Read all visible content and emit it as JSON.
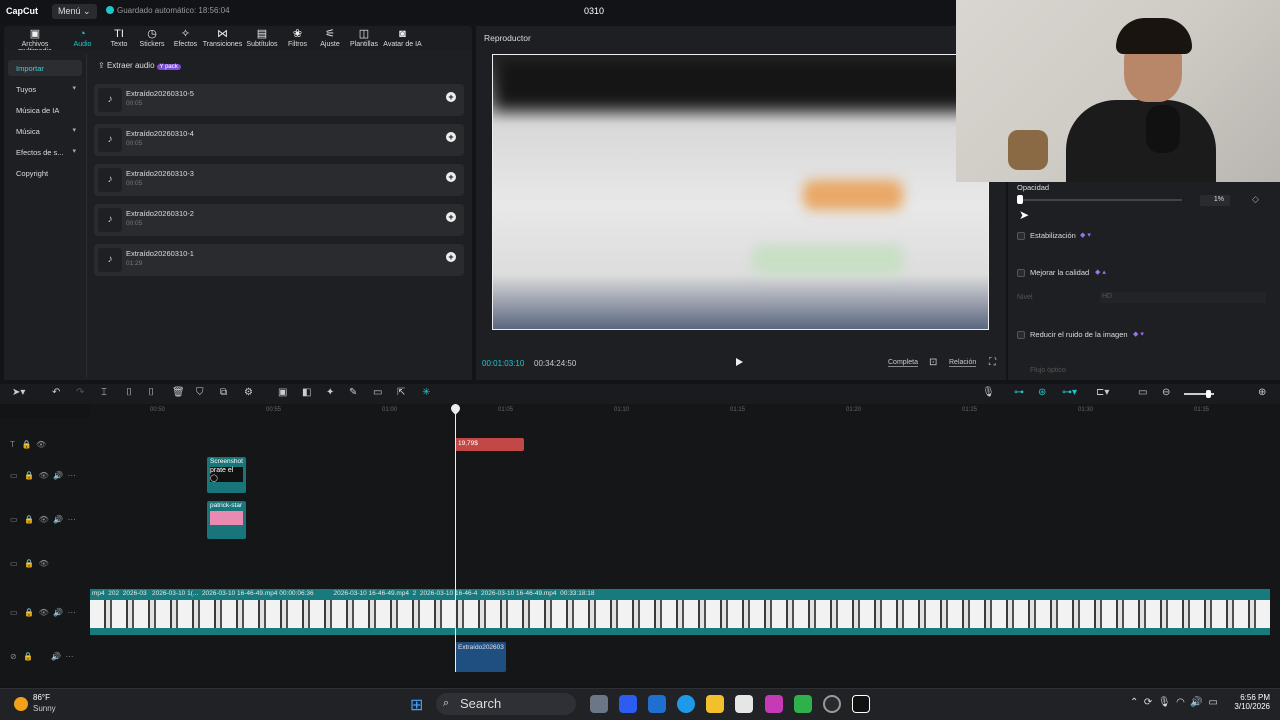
{
  "app": {
    "logo": "CapCut",
    "menu": "Menú ⌄",
    "autosave": "Guardado automático: 18:56:04",
    "project": "0310"
  },
  "toolbar": [
    {
      "label": "Archivos multimedia",
      "icon": "media-icon",
      "glyph": "▣"
    },
    {
      "label": "Audio",
      "icon": "audio-icon",
      "glyph": "◔"
    },
    {
      "label": "Texto",
      "icon": "text-icon",
      "glyph": "TI"
    },
    {
      "label": "Stickers",
      "icon": "sticker-icon",
      "glyph": "◷"
    },
    {
      "label": "Efectos",
      "icon": "effects-icon",
      "glyph": "✧"
    },
    {
      "label": "Transiciones",
      "icon": "transition-icon",
      "glyph": "⋈"
    },
    {
      "label": "Subtítulos",
      "icon": "subtitle-icon",
      "glyph": "▤"
    },
    {
      "label": "Filtros",
      "icon": "filter-icon",
      "glyph": "❀"
    },
    {
      "label": "Ajuste",
      "icon": "adjust-icon",
      "glyph": "⚟"
    },
    {
      "label": "Plantillas",
      "icon": "template-icon",
      "glyph": "◫"
    },
    {
      "label": "Avatar de IA",
      "icon": "avatar-icon",
      "glyph": "◙"
    }
  ],
  "sidebar": [
    "Importar",
    "Tuyos",
    "Música de IA",
    "Música",
    "Efectos de s...",
    "Copyright"
  ],
  "extract": {
    "label": "Extraer audio",
    "badge": "Y pack"
  },
  "audio_items": [
    {
      "name": "Extraído20260310-5",
      "dur": "00:05"
    },
    {
      "name": "Extraído20260310-4",
      "dur": "00:05"
    },
    {
      "name": "Extraído20260310-3",
      "dur": "00:05"
    },
    {
      "name": "Extraído20260310-2",
      "dur": "00:05"
    },
    {
      "name": "Extraído20260310-1",
      "dur": "01:29"
    }
  ],
  "player": {
    "title": "Reproductor",
    "current": "00:01:03:10",
    "total": "00:34:24:50",
    "full": "Completa",
    "ratio": "Relación"
  },
  "right": {
    "opacity_label": "Opacidad",
    "opacity_value": "1%",
    "stab": "Estabilización",
    "quality": "Mejorar la calidad",
    "level": "Nivel",
    "level_val": "HD",
    "noise": "Reducir el ruido de la imagen",
    "optical": "Flujo óptico"
  },
  "timeline": {
    "ticks": [
      "00:50",
      "00:55",
      "01:00",
      "01:05",
      "01:10",
      "01:15",
      "01:20",
      "01:25",
      "01:30",
      "01:35"
    ],
    "price_clip": "19,79$",
    "screenshot_clip": "Screenshot",
    "screenshot_text": "prate el ◯",
    "patrick_clip": "patrick-star",
    "main_labels": [
      "mp4",
      "202",
      "2026-03",
      "2026-03-10 1(...",
      "2026-03-10 16-46-49.mp4",
      "00:00:06:36",
      "2026-03-10 16-46-49.mp4",
      "2",
      "2026-03-10 16-46-4",
      "2026-03-10 16-46-49.mp4",
      "00:33:18:18"
    ],
    "audio_clip": "Extraído202603"
  },
  "taskbar": {
    "temp": "86°F",
    "cond": "Sunny",
    "search": "Search",
    "time": "6:56 PM",
    "date": "3/10/2026"
  }
}
